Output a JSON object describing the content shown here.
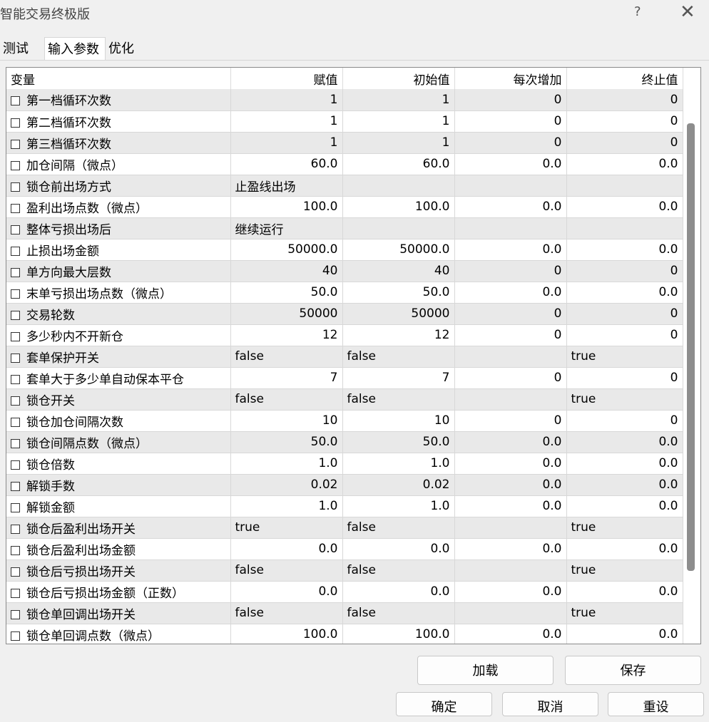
{
  "window": {
    "title": "智能交易终极版",
    "help": "?",
    "close": "✕"
  },
  "tabs": [
    {
      "label": "测试",
      "active": false
    },
    {
      "label": "输入参数",
      "active": true
    },
    {
      "label": "优化",
      "active": false
    }
  ],
  "table": {
    "columns": [
      "变量",
      "赋值",
      "初始值",
      "每次增加",
      "终止值"
    ],
    "rows": [
      {
        "name": "第一档循环次数",
        "value": "1",
        "start": "1",
        "step": "0",
        "stop": "0"
      },
      {
        "name": "第二档循环次数",
        "value": "1",
        "start": "1",
        "step": "0",
        "stop": "0"
      },
      {
        "name": "第三档循环次数",
        "value": "1",
        "start": "1",
        "step": "0",
        "stop": "0"
      },
      {
        "name": "加仓间隔（微点）",
        "value": "60.0",
        "start": "60.0",
        "step": "0.0",
        "stop": "0.0"
      },
      {
        "name": "锁仓前出场方式",
        "value": "止盈线出场",
        "start": "",
        "step": "",
        "stop": "",
        "text": true
      },
      {
        "name": "盈利出场点数（微点）",
        "value": "100.0",
        "start": "100.0",
        "step": "0.0",
        "stop": "0.0"
      },
      {
        "name": "整体亏损出场后",
        "value": "继续运行",
        "start": "",
        "step": "",
        "stop": "",
        "text": true
      },
      {
        "name": "止损出场金额",
        "value": "50000.0",
        "start": "50000.0",
        "step": "0.0",
        "stop": "0.0"
      },
      {
        "name": "单方向最大层数",
        "value": "40",
        "start": "40",
        "step": "0",
        "stop": "0"
      },
      {
        "name": "末单亏损出场点数（微点）",
        "value": "50.0",
        "start": "50.0",
        "step": "0.0",
        "stop": "0.0"
      },
      {
        "name": "交易轮数",
        "value": "50000",
        "start": "50000",
        "step": "0",
        "stop": "0"
      },
      {
        "name": "多少秒内不开新仓",
        "value": "12",
        "start": "12",
        "step": "0",
        "stop": "0"
      },
      {
        "name": "套单保护开关",
        "value": "false",
        "start": "false",
        "step": "",
        "stop": "true",
        "text": true
      },
      {
        "name": "套单大于多少单自动保本平仓",
        "value": "7",
        "start": "7",
        "step": "0",
        "stop": "0"
      },
      {
        "name": "锁仓开关",
        "value": "false",
        "start": "false",
        "step": "",
        "stop": "true",
        "text": true
      },
      {
        "name": "锁仓加仓间隔次数",
        "value": "10",
        "start": "10",
        "step": "0",
        "stop": "0"
      },
      {
        "name": "锁仓间隔点数（微点）",
        "value": "50.0",
        "start": "50.0",
        "step": "0.0",
        "stop": "0.0"
      },
      {
        "name": "锁仓倍数",
        "value": "1.0",
        "start": "1.0",
        "step": "0.0",
        "stop": "0.0"
      },
      {
        "name": "解锁手数",
        "value": "0.02",
        "start": "0.02",
        "step": "0.0",
        "stop": "0.0"
      },
      {
        "name": "解锁金额",
        "value": "1.0",
        "start": "1.0",
        "step": "0.0",
        "stop": "0.0"
      },
      {
        "name": "锁仓后盈利出场开关",
        "value": "true",
        "start": "false",
        "step": "",
        "stop": "true",
        "text": true
      },
      {
        "name": "锁仓后盈利出场金额",
        "value": "0.0",
        "start": "0.0",
        "step": "0.0",
        "stop": "0.0"
      },
      {
        "name": "锁仓后亏损出场开关",
        "value": "false",
        "start": "false",
        "step": "",
        "stop": "true",
        "text": true
      },
      {
        "name": "锁仓后亏损出场金额（正数）",
        "value": "0.0",
        "start": "0.0",
        "step": "0.0",
        "stop": "0.0"
      },
      {
        "name": "锁仓单回调出场开关",
        "value": "false",
        "start": "false",
        "step": "",
        "stop": "true",
        "text": true
      },
      {
        "name": "锁仓单回调点数（微点）",
        "value": "100.0",
        "start": "100.0",
        "step": "0.0",
        "stop": "0.0"
      }
    ]
  },
  "buttons": {
    "load": "加载",
    "save": "保存",
    "ok": "确定",
    "cancel": "取消",
    "reset": "重设"
  }
}
